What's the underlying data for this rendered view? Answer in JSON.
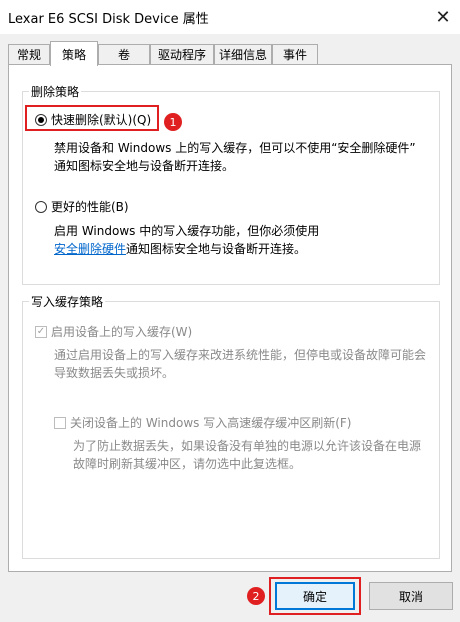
{
  "window": {
    "title": "Lexar E6 SCSI Disk Device 属性",
    "close_glyph": "✕"
  },
  "tabs": [
    "常规",
    "策略",
    "卷",
    "驱动程序",
    "详细信息",
    "事件"
  ],
  "removal_policy": {
    "legend": "删除策略",
    "quick_removal": {
      "label": "快速删除(默认)(Q)",
      "selected": true,
      "description_line1": "禁用设备和 Windows 上的写入缓存，但可以不使用“安全删除硬件”",
      "description_line2": "通知图标安全地与设备断开连接。"
    },
    "better_performance": {
      "label": "更好的性能(B)",
      "selected": false,
      "description_line1": "启用 Windows 中的写入缓存功能，但你必须使用",
      "description_link": "安全删除硬件",
      "description_line2_rest": "通知图标安全地与设备断开连接。"
    }
  },
  "write_cache_policy": {
    "legend": "写入缓存策略",
    "enable_cache": {
      "label": "启用设备上的写入缓存(W)",
      "checked": true,
      "disabled": true,
      "description_line1": "通过启用设备上的写入缓存来改进系统性能，但停电或设备故障可能会",
      "description_line2": "导致数据丢失或损坏。"
    },
    "turn_off_flush": {
      "label": "关闭设备上的 Windows 写入高速缓存缓冲区刷新(F)",
      "checked": false,
      "disabled": true,
      "description_line1": "为了防止数据丢失，如果设备没有单独的电源以允许该设备在电源",
      "description_line2": "故障时刷新其缓冲区，请勿选中此复选框。"
    }
  },
  "annotations": {
    "badge1": "1",
    "badge2": "2",
    "color": "#e02020"
  },
  "buttons": {
    "ok": "确定",
    "cancel": "取消"
  }
}
